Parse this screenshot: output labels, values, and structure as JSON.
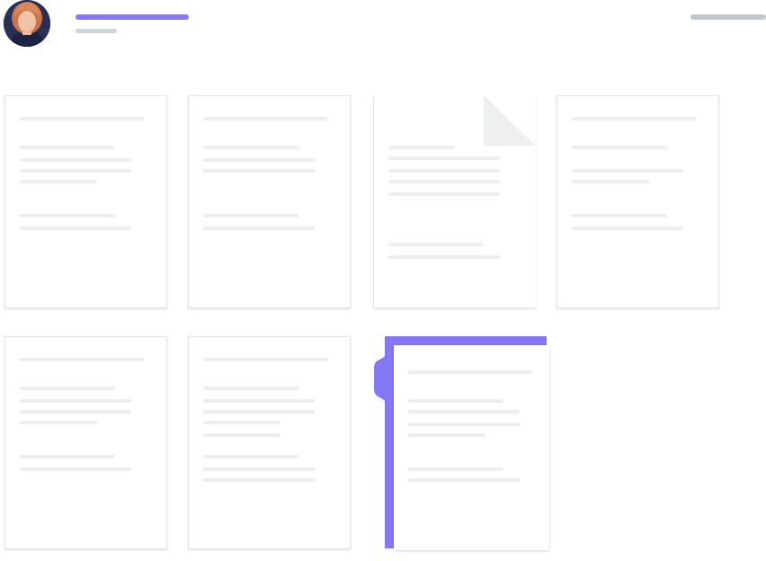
{
  "header": {
    "avatar_icon": "user-avatar-photo",
    "title_placeholder_color": "#8579f6",
    "subtitle_placeholder_color": "#cdd6db",
    "action_placeholder_color": "#c2c7cb"
  },
  "colors": {
    "accent": "#8578f5",
    "doc_line": "#eeeeee",
    "doc_border": "#e2e4e6",
    "fold": "#eef0f0"
  },
  "documents": [
    {
      "name": "document-1",
      "selected": false,
      "folded": false
    },
    {
      "name": "document-2",
      "selected": false,
      "folded": false
    },
    {
      "name": "document-3",
      "selected": false,
      "folded": true
    },
    {
      "name": "document-4",
      "selected": false,
      "folded": false
    },
    {
      "name": "document-5",
      "selected": false,
      "folded": false
    },
    {
      "name": "document-6",
      "selected": false,
      "folded": false
    },
    {
      "name": "document-7",
      "selected": true,
      "folded": false
    }
  ]
}
